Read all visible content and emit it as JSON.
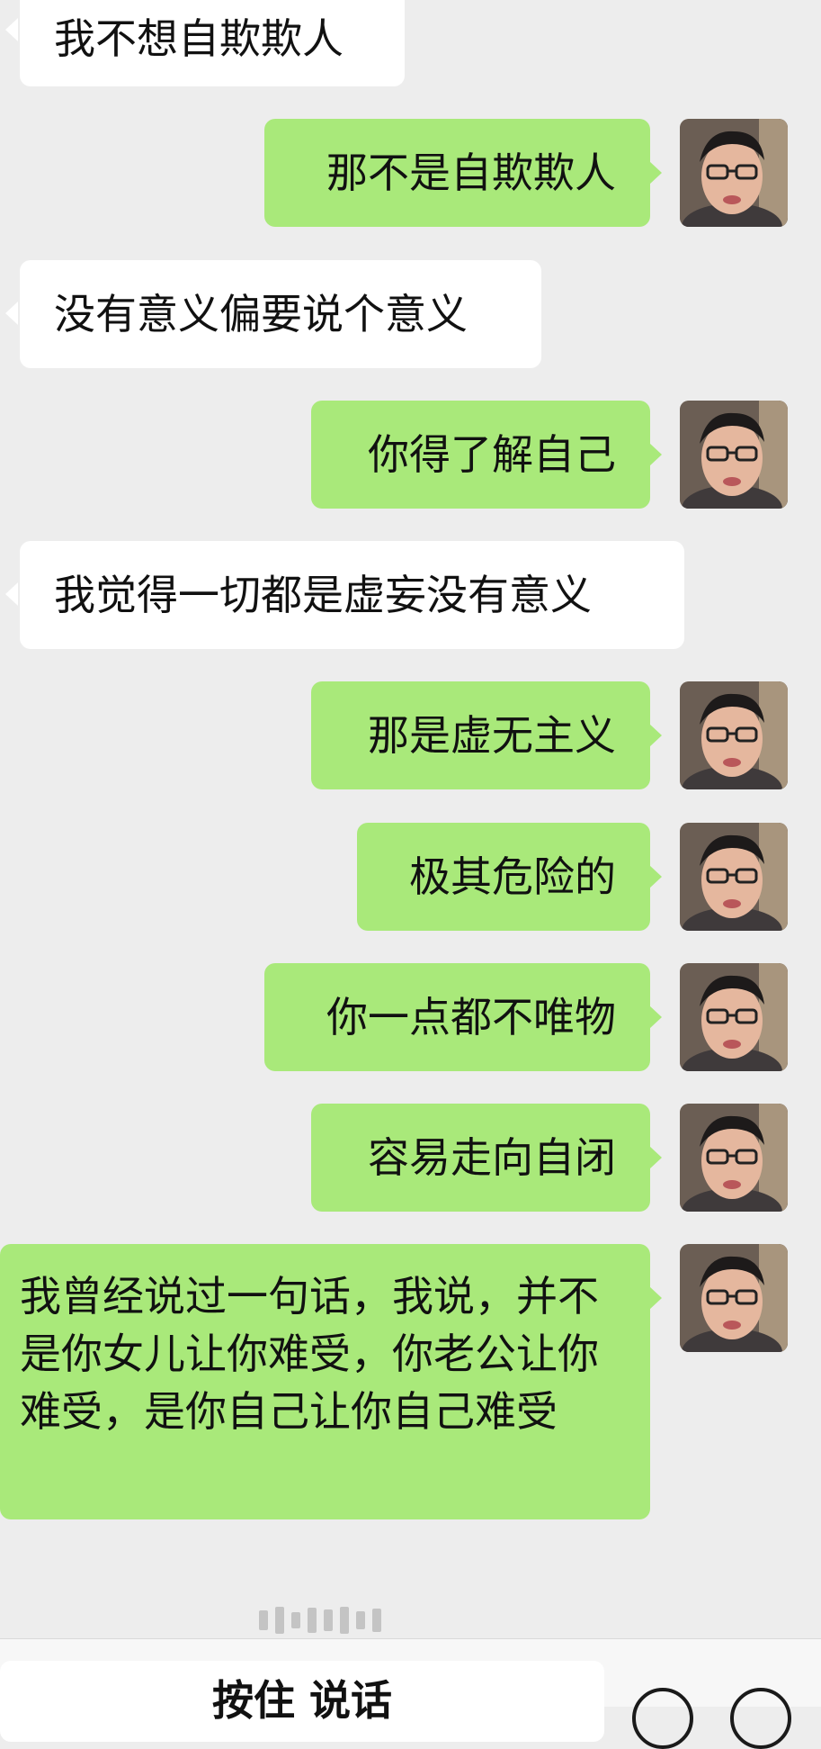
{
  "messages": [
    {
      "side": "in",
      "text": "我不想自欺欺人"
    },
    {
      "side": "out",
      "text": "那不是自欺欺人"
    },
    {
      "side": "in",
      "text": "没有意义偏要说个意义"
    },
    {
      "side": "out",
      "text": "你得了解自己"
    },
    {
      "side": "in",
      "text": "我觉得一切都是虚妄没有意义"
    },
    {
      "side": "out",
      "text": "那是虚无主义"
    },
    {
      "side": "out",
      "text": "极其危险的"
    },
    {
      "side": "out",
      "text": "你一点都不唯物"
    },
    {
      "side": "out",
      "text": "容易走向自闭"
    },
    {
      "side": "out",
      "text": "我曾经说过一句话，我说，并不是你女儿让你难受，你老公让你难受，是你自己让你自己难受"
    }
  ],
  "input_bar": {
    "hold_to_talk_label": "按住 说话"
  },
  "colors": {
    "background": "#ededed",
    "incoming_bubble": "#ffffff",
    "outgoing_bubble": "#a9e97a"
  }
}
